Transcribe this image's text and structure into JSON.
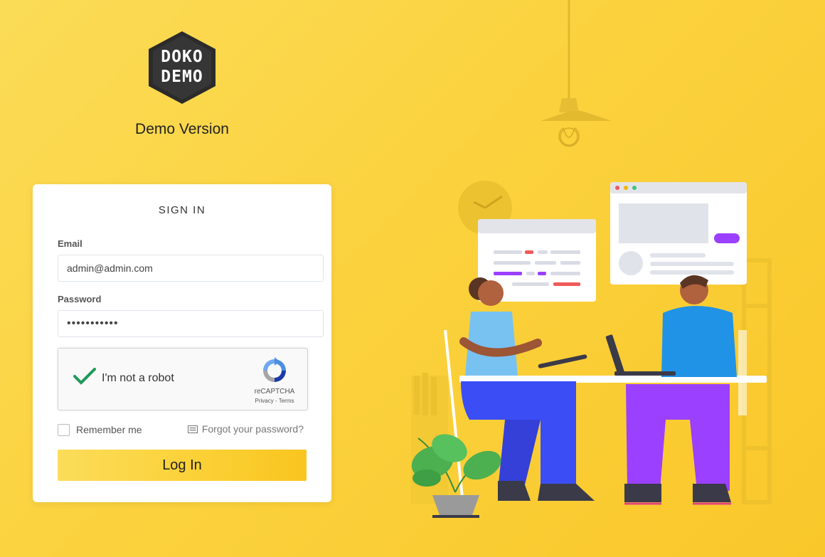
{
  "brand": {
    "logo_text": "DOKO\nDEMO",
    "subtitle": "Demo Version"
  },
  "login": {
    "title": "SIGN IN",
    "email_label": "Email",
    "email_value": "admin@admin.com",
    "password_label": "Password",
    "password_value": "•••••••••••",
    "captcha": {
      "label": "I'm not a robot",
      "brand": "reCAPTCHA",
      "links": "Privacy - Terms",
      "checked": true
    },
    "remember_label": "Remember me",
    "remember_checked": false,
    "forgot_label": "Forgot your password?",
    "submit_label": "Log In"
  },
  "icons": {
    "logo": "hexagon-logo",
    "captcha_check": "check-icon",
    "captcha_logo": "recaptcha-icon",
    "forgot": "keyboard-icon"
  },
  "colors": {
    "background": "#fbd23e",
    "button_start": "#fbdd5a",
    "button_end": "#f9c51f",
    "card": "#ffffff",
    "check_green": "#1f9a5a",
    "accent_purple": "#9b40ff",
    "accent_blue": "#3b4ef5"
  }
}
